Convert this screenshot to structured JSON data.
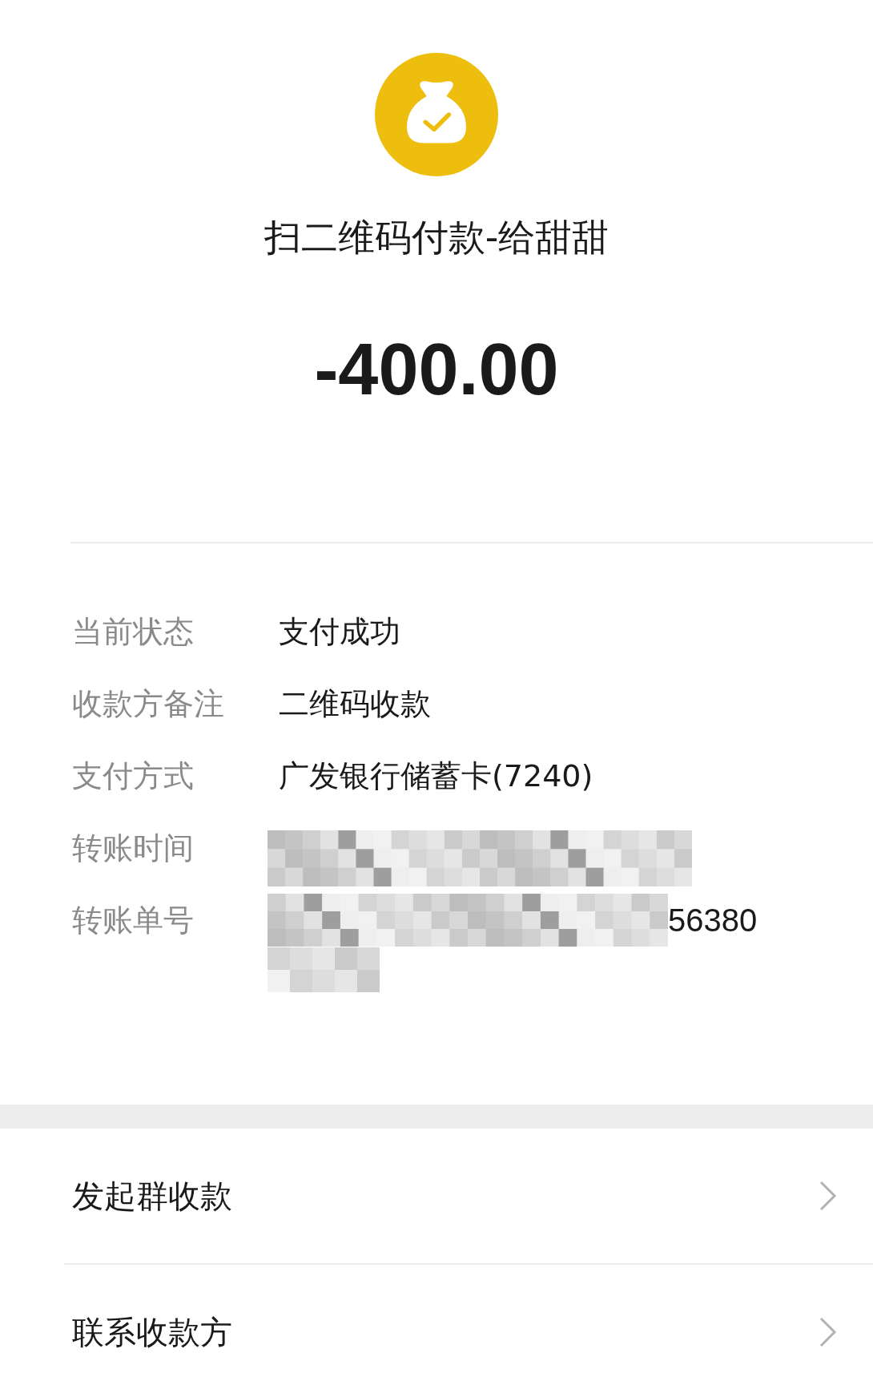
{
  "header": {
    "title": "扫二维码付款-给甜甜",
    "amount": "-400.00"
  },
  "details": [
    {
      "label": "当前状态",
      "kind": "text",
      "value": "支付成功"
    },
    {
      "label": "收款方备注",
      "kind": "text",
      "value": "二维码收款"
    },
    {
      "label": "支付方式",
      "kind": "text",
      "value": "广发银行储蓄卡(7240)"
    },
    {
      "label": "转账时间",
      "kind": "redacted"
    },
    {
      "label": "转账单号",
      "kind": "redacted_tail",
      "value": "56380"
    }
  ],
  "actions": [
    {
      "label": "发起群收款"
    },
    {
      "label": "联系收款方"
    }
  ]
}
